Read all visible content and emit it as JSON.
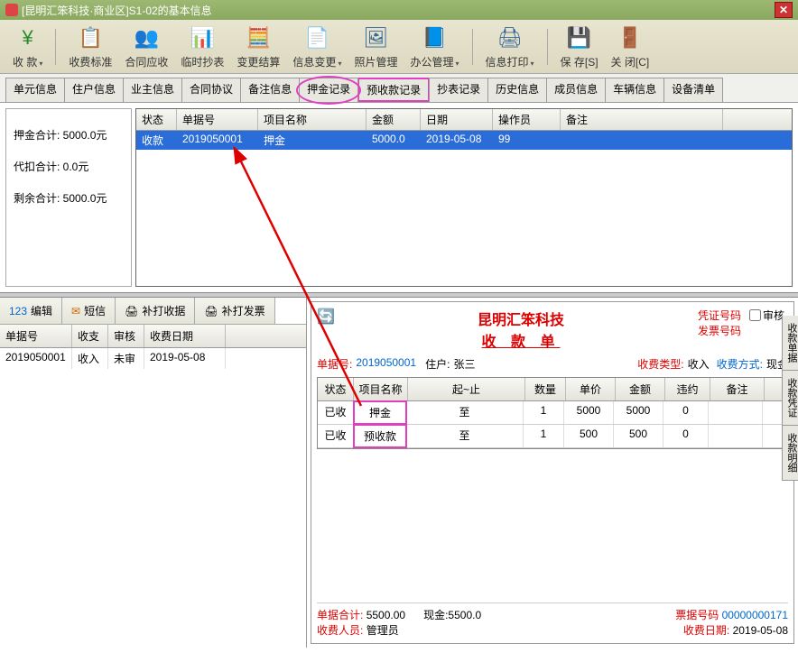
{
  "window": {
    "title": "[昆明汇笨科技·商业区]S1-02的基本信息"
  },
  "toolbar": {
    "items": [
      {
        "label": "收 款",
        "icon": "¥",
        "color": "#2a8a2a",
        "dropdown": true
      },
      {
        "label": "收费标准",
        "icon": "📋",
        "dropdown": false
      },
      {
        "label": "合同应收",
        "icon": "👥",
        "dropdown": false
      },
      {
        "label": "临时抄表",
        "icon": "📊",
        "dropdown": false
      },
      {
        "label": "变更结算",
        "icon": "🧮",
        "dropdown": false
      },
      {
        "label": "信息变更",
        "icon": "📄",
        "dropdown": true
      },
      {
        "label": "照片管理",
        "icon": "🖼",
        "dropdown": false
      },
      {
        "label": "办公管理",
        "icon": "📘",
        "dropdown": true
      },
      {
        "label": "信息打印",
        "icon": "🖨",
        "dropdown": true
      },
      {
        "label": "保 存[S]",
        "icon": "💾",
        "dropdown": false
      },
      {
        "label": "关 闭[C]",
        "icon": "🚪",
        "dropdown": false
      }
    ]
  },
  "tabs": [
    "单元信息",
    "住户信息",
    "业主信息",
    "合同协议",
    "备注信息",
    "押金记录",
    "预收款记录",
    "抄表记录",
    "历史信息",
    "成员信息",
    "车辆信息",
    "设备清单"
  ],
  "summary": {
    "deposit_total": "押金合计: 5000.0元",
    "deduct_total": "代扣合计: 0.0元",
    "remain_total": "剩余合计: 5000.0元"
  },
  "grid": {
    "headers": [
      "状态",
      "单据号",
      "项目名称",
      "金额",
      "日期",
      "操作员",
      "备注"
    ],
    "widths": [
      45,
      90,
      120,
      60,
      80,
      75,
      180
    ],
    "row": [
      "收款",
      "2019050001",
      "押金",
      "5000.0",
      "2019-05-08",
      "99",
      ""
    ]
  },
  "actions": {
    "edit": "编辑",
    "sms": "短信",
    "reprint_receipt": "补打收据",
    "reprint_invoice": "补打发票"
  },
  "left_grid": {
    "headers": [
      "单据号",
      "收支",
      "审核",
      "收费日期"
    ],
    "widths": [
      80,
      40,
      40,
      90
    ],
    "row": [
      "2019050001",
      "收入",
      "未审",
      "2019-05-08"
    ]
  },
  "receipt": {
    "company": "昆明汇笨科技",
    "title": "收 款 单",
    "voucher_label": "凭证号码",
    "invoice_label": "发票号码",
    "audit_label": "审核",
    "doc_no_label": "单据号:",
    "doc_no": "2019050001",
    "tenant_label": "住户:",
    "tenant": "张三",
    "fee_type_label": "收费类型:",
    "fee_type": "收入",
    "pay_method_label": "收费方式:",
    "pay_method": "现金",
    "detail_headers": [
      "状态",
      "项目名称",
      "起~止",
      "数量",
      "单价",
      "金额",
      "违约",
      "备注"
    ],
    "detail_widths": [
      40,
      60,
      130,
      45,
      55,
      55,
      50,
      60
    ],
    "details": [
      {
        "status": "已收",
        "name": "押金",
        "range": "至",
        "qty": "1",
        "price": "5000",
        "amount": "5000",
        "penalty": "0",
        "remark": "",
        "boxed": true
      },
      {
        "status": "已收",
        "name": "预收款",
        "range": "至",
        "qty": "1",
        "price": "500",
        "amount": "500",
        "penalty": "0",
        "remark": "",
        "boxed": true
      }
    ],
    "total_label": "单据合计:",
    "total": "5500.00",
    "cash_label": "现金:",
    "cash": "5500.0",
    "ticket_label": "票据号码",
    "ticket": "00000000171",
    "cashier_label": "收费人员:",
    "cashier": "管理员",
    "date_label": "收费日期:",
    "date": "2019-05-08"
  },
  "side_tabs": [
    "收款单据",
    "收款凭证",
    "收款明细"
  ]
}
